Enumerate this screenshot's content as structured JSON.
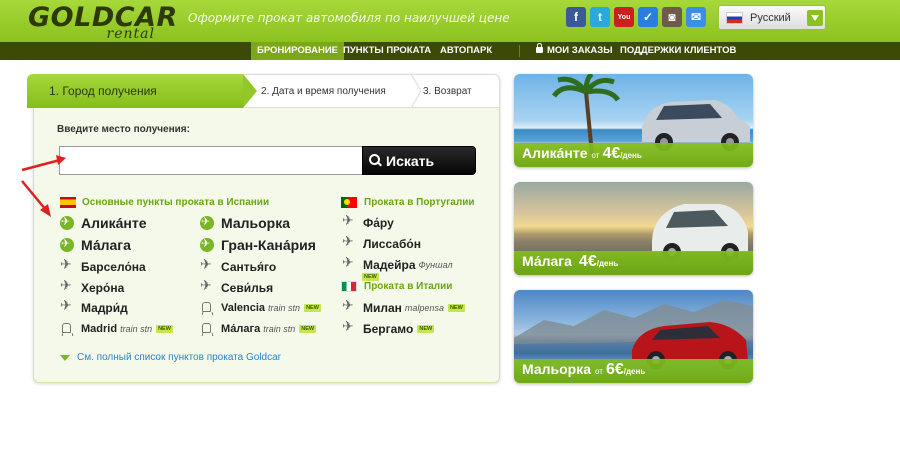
{
  "header": {
    "logo_main": "GOLDCAR",
    "logo_sub": "rental",
    "tagline": "Оформите прокат автомобиля по наилучшей цене",
    "social": [
      {
        "icon": "facebook-icon",
        "glyph": "f"
      },
      {
        "icon": "twitter-icon",
        "glyph": "t"
      },
      {
        "icon": "youtube-icon",
        "glyph": "You"
      },
      {
        "icon": "checkmark-icon",
        "glyph": "✓"
      },
      {
        "icon": "instagram-icon",
        "glyph": "◙"
      },
      {
        "icon": "mail-icon",
        "glyph": "✉"
      }
    ],
    "language": "Русский"
  },
  "nav": {
    "booking": "БРОНИРОВАНИЕ",
    "locations": "ПУНКТЫ ПРОКАТА",
    "fleet": "АВТОПАРК",
    "my_bookings": "МОИ ЗАКАЗЫ",
    "support": "ПОДДЕРЖКИ КЛИЕНТОВ"
  },
  "steps": {
    "step1": "1. Город получения",
    "step2": "2. Дата и время получения",
    "step3": "3. Возврат"
  },
  "search": {
    "label": "Введите место получения:",
    "value": "",
    "button": "Искать"
  },
  "spain": {
    "title": "Основные пункты проката в Испании",
    "col1": [
      {
        "name": "Ащика́нте",
        "icon": "gplane",
        "size": "big"
      },
      {
        "name": "Ма́лага",
        "icon": "gplane",
        "size": "big"
      },
      {
        "name": "Барсело́на",
        "icon": "plane",
        "size": "med"
      },
      {
        "name": "Херо́на",
        "icon": "plane",
        "size": "med"
      },
      {
        "name": "Мадри́д",
        "icon": "plane",
        "size": "med"
      },
      {
        "name": "Madrid",
        "sub": "train stn",
        "new": "NEW",
        "icon": "train",
        "size": "small"
      }
    ],
    "col2": [
      {
        "name": "Мальорка",
        "icon": "gplane",
        "size": "big"
      },
      {
        "name": "Гран-Кана́рия",
        "icon": "gplane",
        "size": "big"
      },
      {
        "name": "Сантья́го",
        "icon": "plane",
        "size": "med"
      },
      {
        "name": "Севи́лья",
        "icon": "plane",
        "size": "med"
      },
      {
        "name": "Valencia",
        "sub": "train stn",
        "new": "NEW",
        "icon": "train",
        "size": "small"
      },
      {
        "name": "Ма́лага",
        "sub": "train stn",
        "new": "NEW",
        "icon": "train",
        "size": "small"
      }
    ]
  },
  "portugal": {
    "title": "Проката в Португалии",
    "items": [
      {
        "name": "Фа́ру"
      },
      {
        "name": "Лиссабо́н"
      },
      {
        "name": "Мадейра",
        "sub": "Фуншал",
        "new": "NEW"
      }
    ]
  },
  "italy": {
    "title": "Проката в Италии",
    "items": [
      {
        "name": "Милан",
        "sub": "malpensa",
        "new": "NEW"
      },
      {
        "name": "Бергамо",
        "new": "NEW"
      }
    ]
  },
  "full_list": "См. полный список пунктов проката Goldcar",
  "promos": [
    {
      "city": "Аликáнте",
      "from": "от",
      "price": "4€",
      "per": "/день"
    },
    {
      "city": "Ма́лага",
      "from": "",
      "price": "4€",
      "per": "/день"
    },
    {
      "city": "Мальорка",
      "from": "от",
      "price": "6€",
      "per": "/день"
    }
  ],
  "colors": {
    "brand_green": "#8cc21f",
    "nav_dark": "#3c4a07",
    "link_blue": "#2a83c7",
    "section_green": "#6aa512"
  }
}
